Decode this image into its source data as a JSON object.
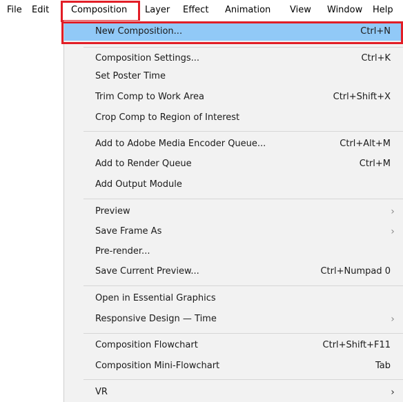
{
  "menubar": {
    "items": [
      "File",
      "Edit",
      "Composition",
      "Layer",
      "Effect",
      "Animation",
      "View",
      "Window",
      "Help"
    ]
  },
  "menu": {
    "items": [
      {
        "label": "New Composition...",
        "shortcut": "Ctrl+N"
      },
      {
        "label": "Composition Settings...",
        "shortcut": "Ctrl+K"
      },
      {
        "label": "Set Poster Time",
        "shortcut": ""
      },
      {
        "label": "Trim Comp to Work Area",
        "shortcut": "Ctrl+Shift+X"
      },
      {
        "label": "Crop Comp to Region of Interest",
        "shortcut": ""
      },
      {
        "label": "Add to Adobe Media Encoder Queue...",
        "shortcut": "Ctrl+Alt+M"
      },
      {
        "label": "Add to Render Queue",
        "shortcut": "Ctrl+M"
      },
      {
        "label": "Add Output Module",
        "shortcut": ""
      },
      {
        "label": "Preview",
        "shortcut": ""
      },
      {
        "label": "Save Frame As",
        "shortcut": ""
      },
      {
        "label": "Pre-render...",
        "shortcut": ""
      },
      {
        "label": "Save Current Preview...",
        "shortcut": "Ctrl+Numpad 0"
      },
      {
        "label": "Open in Essential Graphics",
        "shortcut": ""
      },
      {
        "label": "Responsive Design — Time",
        "shortcut": ""
      },
      {
        "label": "Composition Flowchart",
        "shortcut": "Ctrl+Shift+F11"
      },
      {
        "label": "Composition Mini-Flowchart",
        "shortcut": "Tab"
      },
      {
        "label": "VR",
        "shortcut": ""
      }
    ],
    "submenu_arrow": "›"
  },
  "colors": {
    "menu_background": "#f2f2f2",
    "highlight": "#91c9f7",
    "annotation_outline": "#e21d26"
  }
}
